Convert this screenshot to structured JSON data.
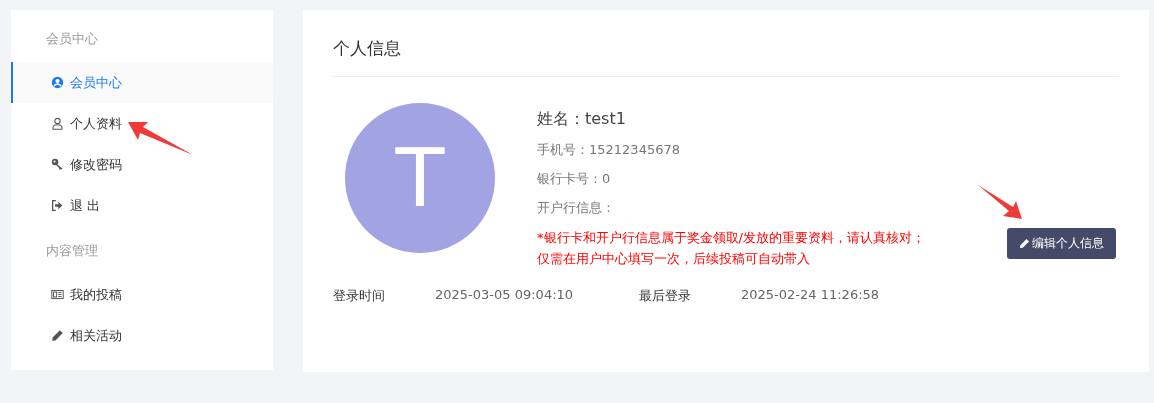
{
  "sidebar": {
    "groups": [
      {
        "heading": "会员中心",
        "items": [
          {
            "label": "会员中心",
            "kind": "user-circle",
            "selected": true
          },
          {
            "label": "个人资料",
            "kind": "user",
            "selected": false
          },
          {
            "label": "修改密码",
            "kind": "key",
            "selected": false
          },
          {
            "label": "退 出",
            "kind": "logout",
            "selected": false
          }
        ]
      },
      {
        "heading": "内容管理",
        "items": [
          {
            "label": "我的投稿",
            "kind": "newspaper",
            "selected": false
          },
          {
            "label": "相关活动",
            "kind": "pencil",
            "selected": false
          }
        ]
      }
    ]
  },
  "profile": {
    "title": "个人信息",
    "avatar_letter": "T",
    "name": "姓名：test1",
    "fields": [
      "手机号：15212345678",
      "银行卡号：0",
      "开户行信息："
    ],
    "notice": [
      "*银行卡和开户行信息属于奖金领取/发放的重要资料，请认真核对；",
      "仅需在用户中心填写一次，后续投稿可自动带入"
    ],
    "edit_button": "编辑个人信息",
    "login": [
      {
        "label": "登录时间",
        "value": "2025-03-05 09:04:10"
      },
      {
        "label": "最后登录",
        "value": "2025-02-24 11:26:58"
      }
    ]
  }
}
